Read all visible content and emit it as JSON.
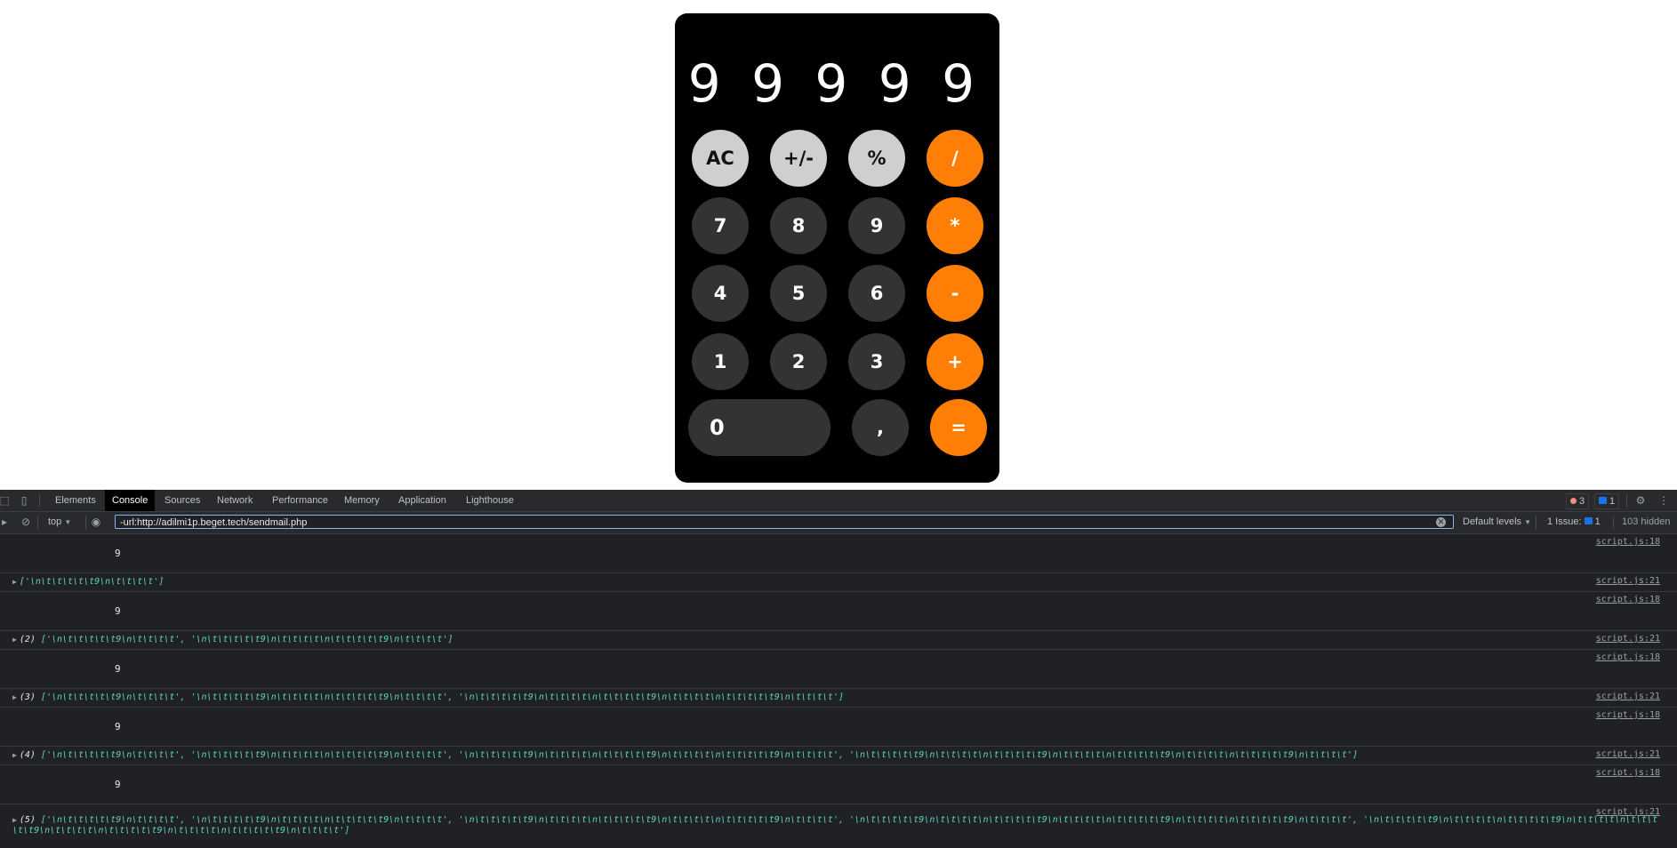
{
  "calculator": {
    "display": "9 9 9 9 9",
    "rows": [
      [
        {
          "label": "AC",
          "style": "light"
        },
        {
          "label": "+/-",
          "style": "light"
        },
        {
          "label": "%",
          "style": "light"
        },
        {
          "label": "/",
          "style": "orange"
        }
      ],
      [
        {
          "label": "7",
          "style": "dark"
        },
        {
          "label": "8",
          "style": "dark"
        },
        {
          "label": "9",
          "style": "dark"
        },
        {
          "label": "*",
          "style": "orange"
        }
      ],
      [
        {
          "label": "4",
          "style": "dark"
        },
        {
          "label": "5",
          "style": "dark"
        },
        {
          "label": "6",
          "style": "dark"
        },
        {
          "label": "-",
          "style": "orange"
        }
      ],
      [
        {
          "label": "1",
          "style": "dark"
        },
        {
          "label": "2",
          "style": "dark"
        },
        {
          "label": "3",
          "style": "dark"
        },
        {
          "label": "+",
          "style": "orange"
        }
      ],
      [
        {
          "label": "0",
          "style": "dark"
        },
        {
          "label": ",",
          "style": "dark"
        },
        {
          "label": "=",
          "style": "orange"
        }
      ]
    ]
  },
  "devtools": {
    "tabs": [
      "Elements",
      "Console",
      "Sources",
      "Network",
      "Performance",
      "Memory",
      "Application",
      "Lighthouse"
    ],
    "active_tab": "Console",
    "errors_count": "3",
    "messages_count": "1",
    "context": "top",
    "filter_value": "-url:http://adilmi1p.beget.tech/sendmail.php",
    "default_levels": "Default levels",
    "issues_label": "1 Issue:",
    "issues_count": "1",
    "hidden": "103 hidden",
    "logs": [
      {
        "type": "value",
        "text": "9",
        "source": "script.js:18"
      },
      {
        "type": "array",
        "prefix": "",
        "text": "['\\n\\t\\t\\t\\t\\t9\\n\\t\\t\\t\\t']",
        "source": "script.js:21"
      },
      {
        "type": "value",
        "text": "9",
        "source": "script.js:18"
      },
      {
        "type": "array",
        "prefix": "(2) ",
        "text": "['\\n\\t\\t\\t\\t\\t9\\n\\t\\t\\t\\t', '\\n\\t\\t\\t\\t\\t9\\n\\t\\t\\t\\t\\n\\t\\t\\t\\t\\t9\\n\\t\\t\\t\\t']",
        "source": "script.js:21"
      },
      {
        "type": "value",
        "text": "9",
        "source": "script.js:18"
      },
      {
        "type": "array",
        "prefix": "(3) ",
        "text": "['\\n\\t\\t\\t\\t\\t9\\n\\t\\t\\t\\t', '\\n\\t\\t\\t\\t\\t9\\n\\t\\t\\t\\t\\n\\t\\t\\t\\t\\t9\\n\\t\\t\\t\\t', '\\n\\t\\t\\t\\t\\t9\\n\\t\\t\\t\\t\\n\\t\\t\\t\\t\\t9\\n\\t\\t\\t\\t\\n\\t\\t\\t\\t\\t9\\n\\t\\t\\t\\t']",
        "source": "script.js:21"
      },
      {
        "type": "value",
        "text": "9",
        "source": "script.js:18"
      },
      {
        "type": "array",
        "prefix": "(4) ",
        "text": "['\\n\\t\\t\\t\\t\\t9\\n\\t\\t\\t\\t', '\\n\\t\\t\\t\\t\\t9\\n\\t\\t\\t\\t\\n\\t\\t\\t\\t\\t9\\n\\t\\t\\t\\t', '\\n\\t\\t\\t\\t\\t9\\n\\t\\t\\t\\t\\n\\t\\t\\t\\t\\t9\\n\\t\\t\\t\\t\\n\\t\\t\\t\\t\\t9\\n\\t\\t\\t\\t', '\\n\\t\\t\\t\\t\\t9\\n\\t\\t\\t\\t\\n\\t\\t\\t\\t\\t9\\n\\t\\t\\t\\t\\n\\t\\t\\t\\t\\t9\\n\\t\\t\\t\\t\\n\\t\\t\\t\\t\\t9\\n\\t\\t\\t\\t']",
        "source": "script.js:21"
      },
      {
        "type": "value",
        "text": "9",
        "source": "script.js:18"
      },
      {
        "type": "array",
        "prefix": "(5) ",
        "text": "['\\n\\t\\t\\t\\t\\t9\\n\\t\\t\\t\\t', '\\n\\t\\t\\t\\t\\t9\\n\\t\\t\\t\\t\\n\\t\\t\\t\\t\\t9\\n\\t\\t\\t\\t', '\\n\\t\\t\\t\\t\\t9\\n\\t\\t\\t\\t\\n\\t\\t\\t\\t\\t9\\n\\t\\t\\t\\t\\n\\t\\t\\t\\t\\t9\\n\\t\\t\\t\\t', '\\n\\t\\t\\t\\t\\t9\\n\\t\\t\\t\\t\\n\\t\\t\\t\\t\\t9\\n\\t\\t\\t\\t\\n\\t\\t\\t\\t\\t9\\n\\t\\t\\t\\t\\n\\t\\t\\t\\t\\t9\\n\\t\\t\\t\\t', '\\n\\t\\t\\t\\t\\t9\\n\\t\\t\\t\\t\\n\\t\\t\\t\\t\\t9\\n\\t\\t\\t\\t\\n\\t\\t\\t\\t\\t9\\n\\t\\t\\t\\t\\n\\t\\t\\t\\t\\t9\\n\\t\\t\\t\\t\\n\\t\\t\\t\\t\\t9\\n\\t\\t\\t\\t']",
        "source": "script.js:21"
      }
    ]
  }
}
